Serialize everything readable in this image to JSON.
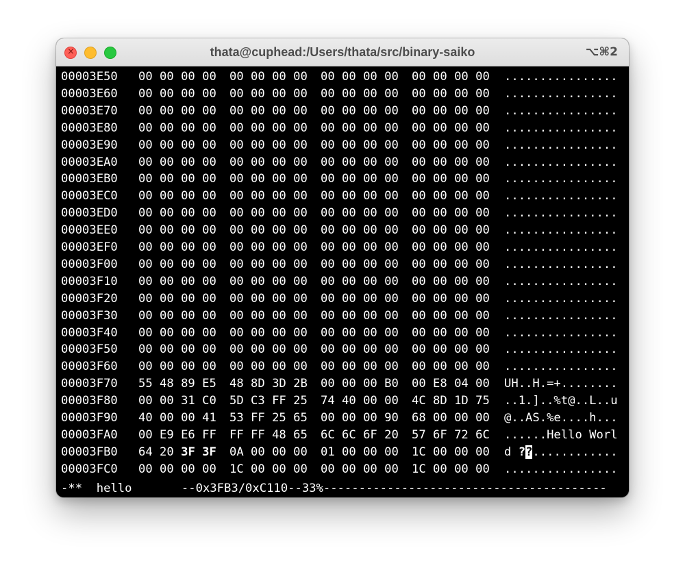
{
  "window": {
    "title": "thata@cuphead:/Users/thata/src/binary-saiko",
    "shortcut": "⌥⌘2",
    "close_glyph": "×"
  },
  "hexdump": {
    "rows": [
      {
        "address": "00003E50",
        "g0": "00 00 00 00",
        "g1": "00 00 00 00",
        "g2": "00 00 00 00",
        "g3": "00 00 00 00",
        "ascii": "................"
      },
      {
        "address": "00003E60",
        "g0": "00 00 00 00",
        "g1": "00 00 00 00",
        "g2": "00 00 00 00",
        "g3": "00 00 00 00",
        "ascii": "................"
      },
      {
        "address": "00003E70",
        "g0": "00 00 00 00",
        "g1": "00 00 00 00",
        "g2": "00 00 00 00",
        "g3": "00 00 00 00",
        "ascii": "................"
      },
      {
        "address": "00003E80",
        "g0": "00 00 00 00",
        "g1": "00 00 00 00",
        "g2": "00 00 00 00",
        "g3": "00 00 00 00",
        "ascii": "................"
      },
      {
        "address": "00003E90",
        "g0": "00 00 00 00",
        "g1": "00 00 00 00",
        "g2": "00 00 00 00",
        "g3": "00 00 00 00",
        "ascii": "................"
      },
      {
        "address": "00003EA0",
        "g0": "00 00 00 00",
        "g1": "00 00 00 00",
        "g2": "00 00 00 00",
        "g3": "00 00 00 00",
        "ascii": "................"
      },
      {
        "address": "00003EB0",
        "g0": "00 00 00 00",
        "g1": "00 00 00 00",
        "g2": "00 00 00 00",
        "g3": "00 00 00 00",
        "ascii": "................"
      },
      {
        "address": "00003EC0",
        "g0": "00 00 00 00",
        "g1": "00 00 00 00",
        "g2": "00 00 00 00",
        "g3": "00 00 00 00",
        "ascii": "................"
      },
      {
        "address": "00003ED0",
        "g0": "00 00 00 00",
        "g1": "00 00 00 00",
        "g2": "00 00 00 00",
        "g3": "00 00 00 00",
        "ascii": "................"
      },
      {
        "address": "00003EE0",
        "g0": "00 00 00 00",
        "g1": "00 00 00 00",
        "g2": "00 00 00 00",
        "g3": "00 00 00 00",
        "ascii": "................"
      },
      {
        "address": "00003EF0",
        "g0": "00 00 00 00",
        "g1": "00 00 00 00",
        "g2": "00 00 00 00",
        "g3": "00 00 00 00",
        "ascii": "................"
      },
      {
        "address": "00003F00",
        "g0": "00 00 00 00",
        "g1": "00 00 00 00",
        "g2": "00 00 00 00",
        "g3": "00 00 00 00",
        "ascii": "................"
      },
      {
        "address": "00003F10",
        "g0": "00 00 00 00",
        "g1": "00 00 00 00",
        "g2": "00 00 00 00",
        "g3": "00 00 00 00",
        "ascii": "................"
      },
      {
        "address": "00003F20",
        "g0": "00 00 00 00",
        "g1": "00 00 00 00",
        "g2": "00 00 00 00",
        "g3": "00 00 00 00",
        "ascii": "................"
      },
      {
        "address": "00003F30",
        "g0": "00 00 00 00",
        "g1": "00 00 00 00",
        "g2": "00 00 00 00",
        "g3": "00 00 00 00",
        "ascii": "................"
      },
      {
        "address": "00003F40",
        "g0": "00 00 00 00",
        "g1": "00 00 00 00",
        "g2": "00 00 00 00",
        "g3": "00 00 00 00",
        "ascii": "................"
      },
      {
        "address": "00003F50",
        "g0": "00 00 00 00",
        "g1": "00 00 00 00",
        "g2": "00 00 00 00",
        "g3": "00 00 00 00",
        "ascii": "................"
      },
      {
        "address": "00003F60",
        "g0": "00 00 00 00",
        "g1": "00 00 00 00",
        "g2": "00 00 00 00",
        "g3": "00 00 00 00",
        "ascii": "................"
      },
      {
        "address": "00003F70",
        "g0": "55 48 89 E5",
        "g1": "48 8D 3D 2B",
        "g2": "00 00 00 B0",
        "g3": "00 E8 04 00",
        "ascii": "UH..H.=+........"
      },
      {
        "address": "00003F80",
        "g0": "00 00 31 C0",
        "g1": "5D C3 FF 25",
        "g2": "74 40 00 00",
        "g3": "4C 8D 1D 75",
        "ascii": "..1.]..%t@..L..u"
      },
      {
        "address": "00003F90",
        "g0": "40 00 00 41",
        "g1": "53 FF 25 65",
        "g2": "00 00 00 90",
        "g3": "68 00 00 00",
        "ascii": "@..AS.%e....h..."
      },
      {
        "address": "00003FA0",
        "g0": "00 E9 E6 FF",
        "g1": "FF FF 48 65",
        "g2": "6C 6C 6F 20",
        "g3": "57 6F 72 6C",
        "ascii": "......Hello Worl"
      },
      {
        "address": "00003FB0",
        "g0_a": "64 20",
        "g0_b": "3F 3F",
        "g1": "0A 00 00 00",
        "g2": "01 00 00 00",
        "g3": "1C 00 00 00",
        "ascii_a": "d ",
        "ascii_b": "?",
        "ascii_cursor": "?",
        "ascii_c": "............"
      },
      {
        "address": "00003FC0",
        "g0": "00 00 00 00",
        "g1": "1C 00 00 00",
        "g2": "00 00 00 00",
        "g3": "1C 00 00 00",
        "ascii": "................"
      }
    ]
  },
  "statusbar": {
    "text": "-**  hello       --0x3FB3/0xC110--33%----------------------------------------"
  }
}
